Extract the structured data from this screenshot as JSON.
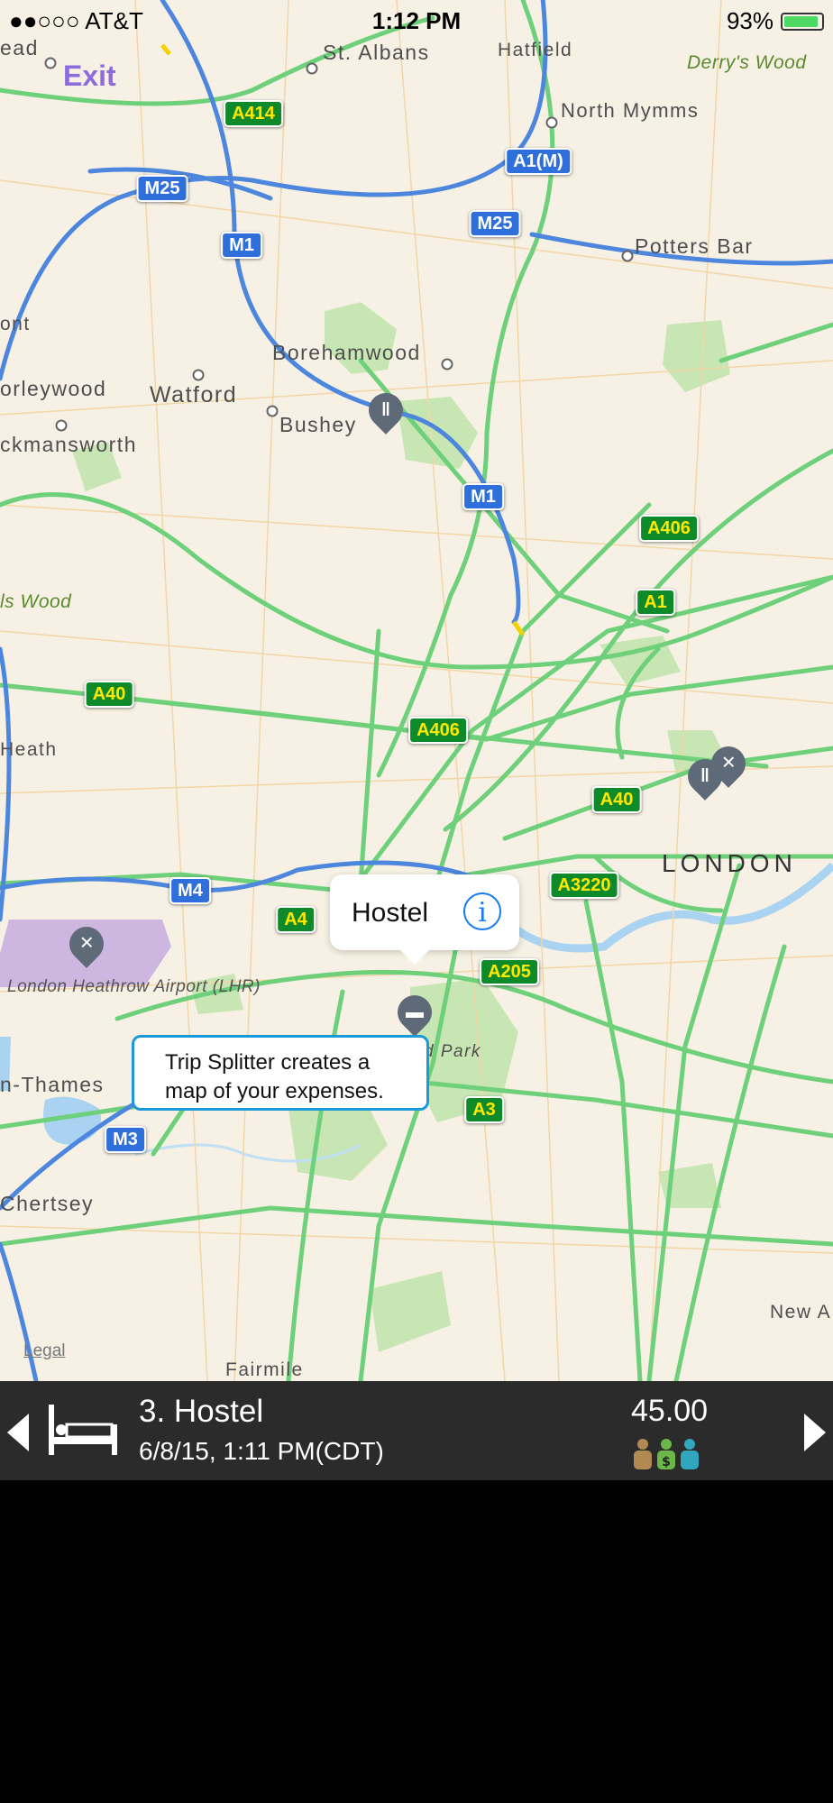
{
  "status_bar": {
    "carrier": "●●○○○ AT&T",
    "time": "1:12 PM",
    "battery": "93%"
  },
  "map": {
    "exit_label": "Exit",
    "places": {
      "st_albans": "St. Albans",
      "hatfield": "Hatfield",
      "derrys_wood": "Derry's Wood",
      "north_mymms": "North Mymms",
      "potters_bar": "Potters Bar",
      "borehamwood": "Borehamwood",
      "watford": "Watford",
      "bushey": "Bushey",
      "orleywood": "orleywood",
      "rickmansworth": "ckmansworth",
      "heath": "Heath",
      "ead": "ead",
      "ont": "ont",
      "ls_wood": "ls Wood",
      "london": "LONDON",
      "heathrow": "London Heathrow Airport (LHR)",
      "thames": "n-Thames",
      "chertsey": "Chertsey",
      "new_a": "New A",
      "fairmile": "Fairmile",
      "park": "d Park"
    },
    "roads": {
      "a414": "A414",
      "m25a": "M25",
      "a1m": "A1(M)",
      "m25b": "M25",
      "m1a": "M1",
      "m1b": "M1",
      "a406a": "A406",
      "a1": "A1",
      "a40a": "A40",
      "a406b": "A406",
      "a40b": "A40",
      "a3220": "A3220",
      "m4": "M4",
      "a4": "A4",
      "a205": "A205",
      "a3": "A3",
      "m3": "M3"
    },
    "legal": "Legal"
  },
  "callout": {
    "title": "Hostel",
    "info_icon": "info-icon"
  },
  "tooltip": {
    "line1": "Trip Splitter creates a",
    "line2": "map of your expenses."
  },
  "expense_bar": {
    "title": "3. Hostel",
    "datetime": "6/8/15, 1:11 PM(CDT)",
    "amount": "45.00",
    "icon": "bed-icon",
    "people_icon": "people-payer-icon",
    "colors": {
      "bar": "#2b2b2b",
      "person_brown": "#b08a52",
      "person_green": "#6bb74a",
      "person_teal": "#31a6bd"
    }
  }
}
